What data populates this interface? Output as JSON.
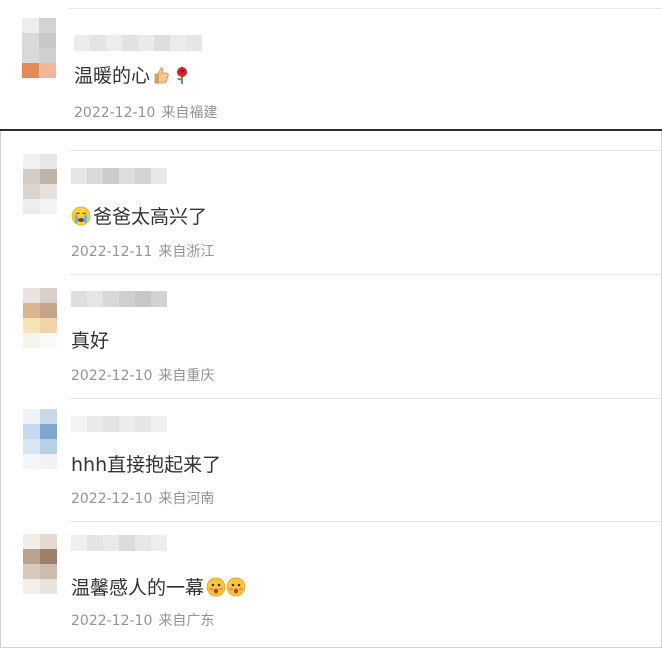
{
  "comments": [
    {
      "text": "温暖的心",
      "emojis": [
        "thumbs-up-icon",
        "rose-icon"
      ],
      "date": "2022-12-10",
      "location": "来自福建",
      "avatar_colors": [
        "#eeeeee",
        "#d3d3d3",
        "#dadada",
        "#c8c8c8",
        "#d9d9d9",
        "#cfcfcf",
        "#e38a58",
        "#f0b79a"
      ],
      "username_colors": [
        "#ececec",
        "#e4e4e4",
        "#ededed",
        "#e2e2e2",
        "#eaeaea",
        "#dedede",
        "#ebebeb",
        "#e6e6e6"
      ]
    },
    {
      "text": "爸爸太高兴了",
      "emojis": [
        "crying-face-icon"
      ],
      "date": "2022-12-11",
      "location": "来自浙江",
      "avatar_colors": [
        "#f2f2f2",
        "#e7e7e7",
        "#d4cdc6",
        "#bfb2a7",
        "#dcd5ce",
        "#e6e1dc",
        "#ededed",
        "#f3f3f3"
      ],
      "username_colors": [
        "#e6e6e6",
        "#d9d9d9",
        "#cccccc",
        "#dedede",
        "#d3d3d3",
        "#e8e8e8"
      ]
    },
    {
      "text": "真好",
      "emojis": [],
      "date": "2022-12-10",
      "location": "来自重庆",
      "avatar_colors": [
        "#e8e3e0",
        "#d8cfca",
        "#dcb58f",
        "#c7a48a",
        "#f6e3b7",
        "#efd5a9",
        "#f7f4ee",
        "#fbfaf8"
      ],
      "username_colors": [
        "#dedede",
        "#e6e6e6",
        "#d8d8d8",
        "#cfcfcf",
        "#c7c7c7",
        "#d2d2d2"
      ]
    },
    {
      "text": "hhh直接抱起来了",
      "emojis": [],
      "date": "2022-12-10",
      "location": "来自河南",
      "avatar_colors": [
        "#eef3f8",
        "#c9d8e7",
        "#c5d9ee",
        "#7fa6cf",
        "#d9e6f2",
        "#b9cfe4",
        "#f4f7fa",
        "#eef2f6"
      ],
      "username_colors": [
        "#f3f3f3",
        "#eaeaea",
        "#e3e3e3",
        "#ececec",
        "#e6e6e6",
        "#f0f0f0"
      ]
    },
    {
      "text": "温馨感人的一幕",
      "emojis": [
        "surprised-face-icon",
        "surprised-face-icon"
      ],
      "date": "2022-12-10",
      "location": "来自广东",
      "avatar_colors": [
        "#f1ede9",
        "#e3d9cf",
        "#b9a391",
        "#9c8069",
        "#d6c9bd",
        "#cbbcae",
        "#f3efeb",
        "#e9e3dd"
      ],
      "username_colors": [
        "#efefef",
        "#e4e4e4",
        "#eaeaea",
        "#dcdcdc",
        "#e7e7e7",
        "#ededed"
      ]
    }
  ]
}
